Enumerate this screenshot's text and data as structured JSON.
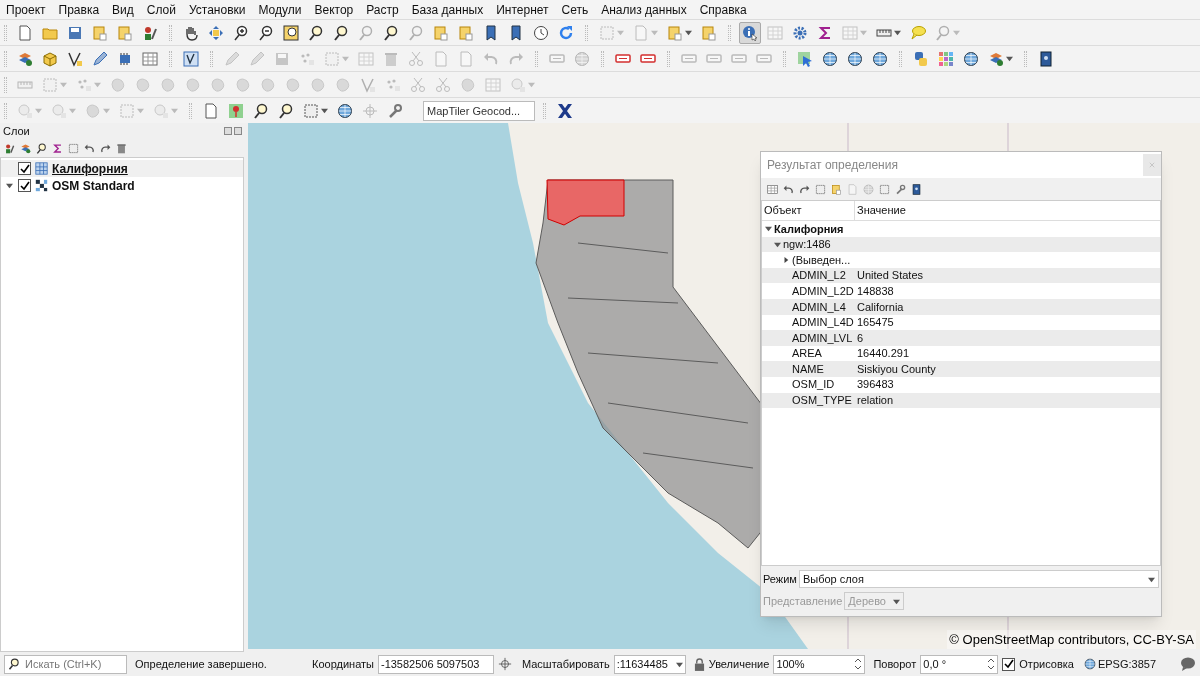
{
  "menu": [
    "Проект",
    "Правка",
    "Вид",
    "Слой",
    "Установки",
    "Модули",
    "Вектор",
    "Растр",
    "База данных",
    "Интернет",
    "Сеть",
    "Анализ данных",
    "Справка"
  ],
  "toolbars": [
    [
      {
        "kind": "doc",
        "disabled": false
      },
      {
        "kind": "folder",
        "disabled": false
      },
      {
        "kind": "floppy",
        "disabled": false
      },
      {
        "kind": "layout",
        "disabled": false
      },
      {
        "kind": "layout",
        "disabled": false
      },
      {
        "kind": "style",
        "disabled": false
      },
      {
        "kind": "sep"
      },
      {
        "kind": "hand",
        "disabled": false
      },
      {
        "kind": "arrows",
        "disabled": false
      },
      {
        "kind": "zoomin",
        "disabled": false
      },
      {
        "kind": "zoomout",
        "disabled": false
      },
      {
        "kind": "zoomfull",
        "disabled": false
      },
      {
        "kind": "magnifier",
        "disabled": false
      },
      {
        "kind": "magnifier",
        "disabled": false
      },
      {
        "kind": "magnifier",
        "disabled": true
      },
      {
        "kind": "magnifier",
        "disabled": false
      },
      {
        "kind": "magnifier",
        "disabled": true
      },
      {
        "kind": "layout",
        "disabled": false
      },
      {
        "kind": "layout",
        "disabled": false
      },
      {
        "kind": "bookmark",
        "disabled": false
      },
      {
        "kind": "bookmark",
        "disabled": false
      },
      {
        "kind": "clock",
        "disabled": false
      },
      {
        "kind": "refresh",
        "disabled": false
      },
      {
        "kind": "sep"
      },
      {
        "kind": "select",
        "disabled": true,
        "dropdown": true
      },
      {
        "kind": "doc",
        "disabled": true,
        "dropdown": true
      },
      {
        "kind": "layout",
        "disabled": false,
        "dropdown": true
      },
      {
        "kind": "layout",
        "disabled": false
      },
      {
        "kind": "sep"
      },
      {
        "kind": "identify",
        "disabled": false,
        "selected": true
      },
      {
        "kind": "table",
        "disabled": true
      },
      {
        "kind": "gear",
        "disabled": false
      },
      {
        "kind": "sigma",
        "disabled": false
      },
      {
        "kind": "table",
        "disabled": true,
        "dropdown": true
      },
      {
        "kind": "ruler",
        "disabled": false,
        "dropdown": true
      },
      {
        "kind": "bubble",
        "disabled": false
      },
      {
        "kind": "magnifier",
        "disabled": true,
        "dropdown": true
      }
    ],
    [
      {
        "kind": "layers",
        "disabled": false
      },
      {
        "kind": "cube",
        "disabled": false
      },
      {
        "kind": "vertex",
        "disabled": false
      },
      {
        "kind": "pencil",
        "disabled": false
      },
      {
        "kind": "chip",
        "disabled": false
      },
      {
        "kind": "table",
        "disabled": false
      },
      {
        "kind": "sep"
      },
      {
        "kind": "checkbox",
        "disabled": false
      },
      {
        "kind": "sep"
      },
      {
        "kind": "pencil",
        "disabled": true
      },
      {
        "kind": "pencil",
        "disabled": true
      },
      {
        "kind": "floppy",
        "disabled": true
      },
      {
        "kind": "dots",
        "disabled": true
      },
      {
        "kind": "select",
        "disabled": true,
        "dropdown": true
      },
      {
        "kind": "table",
        "disabled": true
      },
      {
        "kind": "trash",
        "disabled": true
      },
      {
        "kind": "scissors",
        "disabled": true
      },
      {
        "kind": "doc",
        "disabled": true
      },
      {
        "kind": "doc",
        "disabled": true
      },
      {
        "kind": "undo",
        "disabled": true
      },
      {
        "kind": "redo",
        "disabled": true
      },
      {
        "kind": "sep"
      },
      {
        "kind": "label",
        "disabled": true
      },
      {
        "kind": "globe",
        "disabled": true
      },
      {
        "kind": "sep"
      },
      {
        "kind": "label",
        "disabled": false
      },
      {
        "kind": "label",
        "disabled": false
      },
      {
        "kind": "sep"
      },
      {
        "kind": "label",
        "disabled": true
      },
      {
        "kind": "label",
        "disabled": true
      },
      {
        "kind": "label",
        "disabled": true
      },
      {
        "kind": "label",
        "disabled": true
      },
      {
        "kind": "sep"
      },
      {
        "kind": "cursor",
        "disabled": false
      },
      {
        "kind": "globe",
        "disabled": false
      },
      {
        "kind": "globe",
        "disabled": false
      },
      {
        "kind": "globe",
        "disabled": false
      },
      {
        "kind": "sep"
      },
      {
        "kind": "twotone",
        "disabled": false
      },
      {
        "kind": "colorgrid",
        "disabled": false
      },
      {
        "kind": "globe",
        "disabled": false
      },
      {
        "kind": "layers",
        "disabled": false,
        "dropdown": true
      },
      {
        "kind": "sep"
      },
      {
        "kind": "book",
        "disabled": false
      }
    ],
    [
      {
        "kind": "ruler",
        "disabled": true
      },
      {
        "kind": "select",
        "disabled": true,
        "dropdown": true
      },
      {
        "kind": "dots",
        "disabled": true,
        "dropdown": true
      },
      {
        "kind": "blob",
        "disabled": true
      },
      {
        "kind": "blob",
        "disabled": true
      },
      {
        "kind": "blob",
        "disabled": true
      },
      {
        "kind": "blob",
        "disabled": true
      },
      {
        "kind": "blob",
        "disabled": true
      },
      {
        "kind": "blob",
        "disabled": true
      },
      {
        "kind": "blob",
        "disabled": true
      },
      {
        "kind": "blob",
        "disabled": true
      },
      {
        "kind": "blob",
        "disabled": true
      },
      {
        "kind": "blob",
        "disabled": true
      },
      {
        "kind": "vertex",
        "disabled": true
      },
      {
        "kind": "dots",
        "disabled": true
      },
      {
        "kind": "scissors",
        "disabled": true
      },
      {
        "kind": "scissors",
        "disabled": true
      },
      {
        "kind": "blob",
        "disabled": true
      },
      {
        "kind": "table",
        "disabled": true
      },
      {
        "kind": "shape",
        "disabled": true,
        "dropdown": true
      }
    ],
    [
      {
        "kind": "shape",
        "disabled": true,
        "dropdown": true
      },
      {
        "kind": "shape",
        "disabled": true,
        "dropdown": true
      },
      {
        "kind": "blob",
        "disabled": true,
        "dropdown": true
      },
      {
        "kind": "select",
        "disabled": true,
        "dropdown": true
      },
      {
        "kind": "shape",
        "disabled": true,
        "dropdown": true
      },
      {
        "kind": "sep"
      },
      {
        "kind": "doc",
        "disabled": false
      },
      {
        "kind": "pin",
        "disabled": false
      },
      {
        "kind": "magnifier",
        "disabled": false
      },
      {
        "kind": "magnifier",
        "disabled": false
      },
      {
        "kind": "select",
        "disabled": false,
        "dropdown": true
      },
      {
        "kind": "globe",
        "disabled": false
      },
      {
        "kind": "crosshair",
        "disabled": true
      },
      {
        "kind": "wrench",
        "disabled": false
      },
      {
        "kind": "geocoder"
      },
      {
        "kind": "sep"
      },
      {
        "kind": "xlogo",
        "disabled": false
      }
    ]
  ],
  "geocoder": {
    "placeholder": "MapTiler Geocod..."
  },
  "layers_panel": {
    "title": "Слои",
    "layers": [
      {
        "name": "Калифорния",
        "kind": "vector",
        "checked": true,
        "selected": true,
        "expanded": false
      },
      {
        "name": "OSM Standard",
        "kind": "raster",
        "checked": true,
        "selected": false,
        "expanded": true
      }
    ]
  },
  "map": {
    "attribution": "© OpenStreetMap contributors, CC-BY-SA"
  },
  "identify": {
    "title": "Результат определения",
    "columns": [
      "Объект",
      "Значение"
    ],
    "tree": [
      {
        "label": "Калифорния",
        "expanded": true,
        "children": [
          {
            "label": "ngw:1486",
            "expanded": true,
            "children": [
              {
                "label": "(Выведен...",
                "expanded": false
              },
              {
                "label": "ADMIN_L2",
                "value": "United States"
              },
              {
                "label": "ADMIN_L2D",
                "value": "148838"
              },
              {
                "label": "ADMIN_L4",
                "value": "California"
              },
              {
                "label": "ADMIN_L4D",
                "value": "165475"
              },
              {
                "label": "ADMIN_LVL",
                "value": "6"
              },
              {
                "label": "AREA",
                "value": "16440.291"
              },
              {
                "label": "NAME",
                "value": "Siskiyou County"
              },
              {
                "label": "OSM_ID",
                "value": "396483"
              },
              {
                "label": "OSM_TYPE",
                "value": "relation"
              }
            ]
          }
        ]
      }
    ],
    "mode": {
      "label": "Режим",
      "value": "Выбор слоя",
      "disabled": false
    },
    "view": {
      "label": "Представление",
      "value": "Дерево",
      "disabled": true
    }
  },
  "status_bar": {
    "search_placeholder": "Искать (Ctrl+K)",
    "message": "Определение завершено.",
    "coordinates_label": "Координаты",
    "coordinates": "-13582506 5097503",
    "scale_label": "Масштабировать",
    "scale": ":11634485",
    "magnifier_label": "Увеличение",
    "magnifier": "100%",
    "rotation_label": "Поворот",
    "rotation": "0,0 °",
    "render": {
      "label": "Отрисовка",
      "checked": true
    },
    "crs": "EPSG:3857"
  }
}
